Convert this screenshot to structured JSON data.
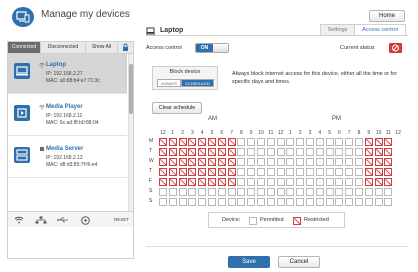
{
  "header": {
    "title": "Manage my devices",
    "home_label": "Home"
  },
  "filters": {
    "connected": "Connected",
    "disconnected": "Disconnected",
    "show_all": "Show All"
  },
  "devices": [
    {
      "name": "Laptop",
      "ip": "IP: 192.168.2.27",
      "mac": "MAC: a0:88:b4:e7:71:3c"
    },
    {
      "name": "Media Player",
      "ip": "IP: 192.168.2.11",
      "mac": "MAC: 6c:ad:f8:b0:88:04"
    },
    {
      "name": "Media Server",
      "ip": "IP: 192.168.2.12",
      "mac": "MAC: d8:d3:85:7f:f6:e4"
    }
  ],
  "icon_bar": {
    "reset_label": "RESET"
  },
  "detail": {
    "device_name": "Laptop",
    "tabs": {
      "settings": "Settings",
      "access_control": "Access control"
    },
    "access_control_label": "Access control",
    "toggle_on": "ON",
    "current_status_label": "Current status",
    "block_device_title": "Block device",
    "always_label": "ALWAYS",
    "scheduled_label": "SCHEDULED",
    "block_description": "Always block internet access for this device, either all the time or for specific days and times.",
    "clear_schedule_label": "Clear schedule",
    "am_label": "AM",
    "pm_label": "PM",
    "hours": [
      "12",
      "1",
      "2",
      "3",
      "4",
      "5",
      "6",
      "7",
      "8",
      "9",
      "10",
      "11",
      "12",
      "1",
      "2",
      "3",
      "4",
      "5",
      "6",
      "7",
      "8",
      "9",
      "10",
      "11",
      "12"
    ],
    "days": [
      "M",
      "T",
      "W",
      "T",
      "F",
      "S",
      "S"
    ],
    "schedule_restricted_hours_weekdays": "12 AM–8 AM and 9 PM–12 AM, Monday–Friday",
    "legend_device": "Device:",
    "legend_permitted": "Permitted",
    "legend_restricted": "Restricted"
  },
  "footer": {
    "save_label": "Save",
    "cancel_label": "Cancel"
  },
  "colors": {
    "accent": "#2f6fae",
    "restricted": "#d04040"
  }
}
